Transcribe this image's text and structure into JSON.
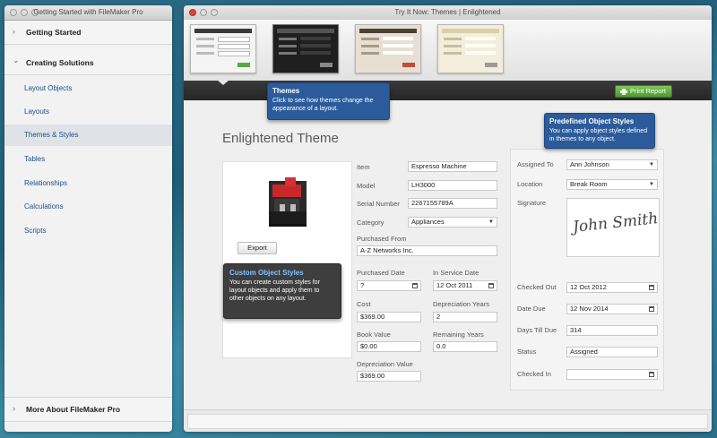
{
  "left_window": {
    "title": "Getting Started with FileMaker Pro",
    "sections": {
      "getting_started": "Getting Started",
      "creating_solutions": "Creating Solutions",
      "more_about": "More About FileMaker Pro"
    },
    "items": [
      {
        "label": "Layout Objects",
        "selected": false
      },
      {
        "label": "Layouts",
        "selected": false
      },
      {
        "label": "Themes & Styles",
        "selected": true
      },
      {
        "label": "Tables",
        "selected": false
      },
      {
        "label": "Relationships",
        "selected": false
      },
      {
        "label": "Calculations",
        "selected": false
      },
      {
        "label": "Scripts",
        "selected": false
      }
    ],
    "chevrons": {
      "collapsed": "›",
      "expanded": "⌄"
    }
  },
  "main_window": {
    "title": "Try It Now: Themes | Enlightened",
    "print_button": "Print Report",
    "layout_title": "Enlightened Theme",
    "export_button": "Export",
    "callouts": {
      "themes": {
        "title": "Themes",
        "text": "Click to see how themes change the appearance of a layout."
      },
      "predefined": {
        "title": "Predefined Object Styles",
        "text": "You can apply object styles defined in themes to any object."
      },
      "custom": {
        "title": "Custom Object Styles",
        "text": "You can create custom styles for layout objects and apply them to other objects on any layout."
      }
    },
    "fields": {
      "item": {
        "label": "Item",
        "value": "Espresso Machine"
      },
      "model": {
        "label": "Model",
        "value": "LH3000"
      },
      "serial": {
        "label": "Serial Number",
        "value": "2267155789A"
      },
      "category": {
        "label": "Category",
        "value": "Appliances"
      },
      "purchased_from": {
        "label": "Purchased From",
        "value": "A-Z Networks Inc."
      },
      "purchased_date": {
        "label": "Purchased Date",
        "value": "?"
      },
      "in_service_date": {
        "label": "In Service Date",
        "value": "12 Oct 2011"
      },
      "cost": {
        "label": "Cost",
        "value": "$369.00"
      },
      "depreciation_years": {
        "label": "Depreciation Years",
        "value": "2"
      },
      "book_value": {
        "label": "Book Value",
        "value": "$0.00"
      },
      "remaining_years": {
        "label": "Remaining Years",
        "value": "0.0"
      },
      "depreciation_value": {
        "label": "Depreciation Value",
        "value": "$369.00"
      },
      "assigned_to": {
        "label": "Assigned To",
        "value": "Ann Johnson"
      },
      "location": {
        "label": "Location",
        "value": "Break Room"
      },
      "signature": {
        "label": "Signature",
        "value": "John Smith"
      },
      "checked_out": {
        "label": "Checked Out",
        "value": "12 Oct 2012"
      },
      "date_due": {
        "label": "Date Due",
        "value": "12 Nov 2014"
      },
      "days_till_due": {
        "label": "Days Till Due",
        "value": "314"
      },
      "status": {
        "label": "Status",
        "value": "Assigned"
      },
      "checked_in": {
        "label": "Checked In",
        "value": ""
      }
    }
  },
  "colors": {
    "accent_blue": "#2c5b9b",
    "print_green": "#5aa83b",
    "dark_bar": "#2e2e2e",
    "nav_link": "#1d4f87"
  }
}
